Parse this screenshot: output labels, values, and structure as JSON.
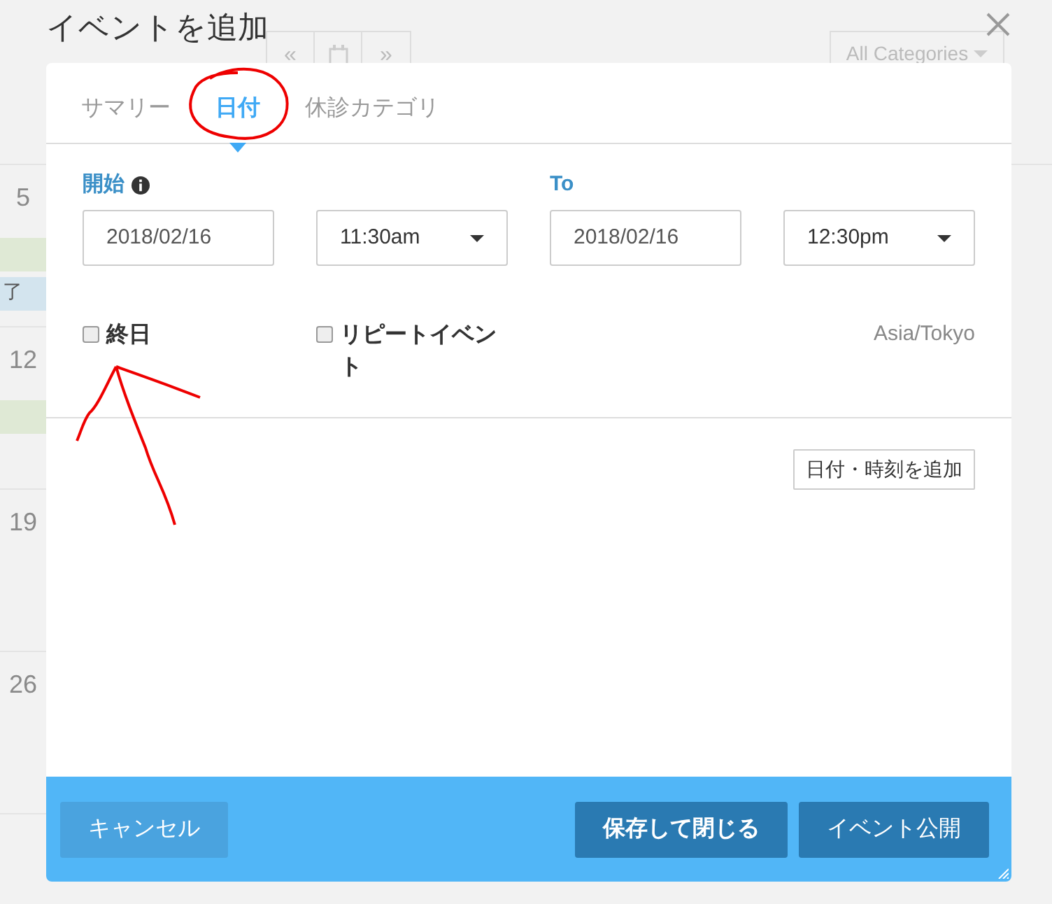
{
  "background": {
    "nav_buttons": [
      "«",
      "»"
    ],
    "category_filter": "All Categories",
    "weeks": [
      {
        "day": "5",
        "bands": [
          {
            "color": "#dfe9d5"
          },
          {
            "text": "了",
            "color": "#d3e4ee"
          }
        ]
      },
      {
        "day": "12",
        "bands": [
          {
            "color": "#dfe9d5"
          }
        ]
      },
      {
        "day": "19"
      },
      {
        "day": "26"
      }
    ]
  },
  "dialog": {
    "title": "イベントを追加",
    "tabs": [
      {
        "label": "サマリー",
        "selected": false
      },
      {
        "label": "日付",
        "selected": true
      },
      {
        "label": "休診カテゴリ",
        "selected": false
      }
    ],
    "start": {
      "label": "開始",
      "date": "2018/02/16",
      "time": "11:30am"
    },
    "end": {
      "label": "To",
      "date": "2018/02/16",
      "time": "12:30pm"
    },
    "options": [
      {
        "label": "終日",
        "checked": false
      },
      {
        "label": "リピートイベント",
        "checked": false
      }
    ],
    "timezone": "Asia/Tokyo",
    "add_date_button": "日付・時刻を追加",
    "buttons": [
      {
        "label": "キャンセル",
        "kind": "secondary"
      },
      {
        "label": "保存して閉じる",
        "kind": "primary"
      },
      {
        "label": "イベント公開",
        "kind": "primary"
      }
    ]
  }
}
